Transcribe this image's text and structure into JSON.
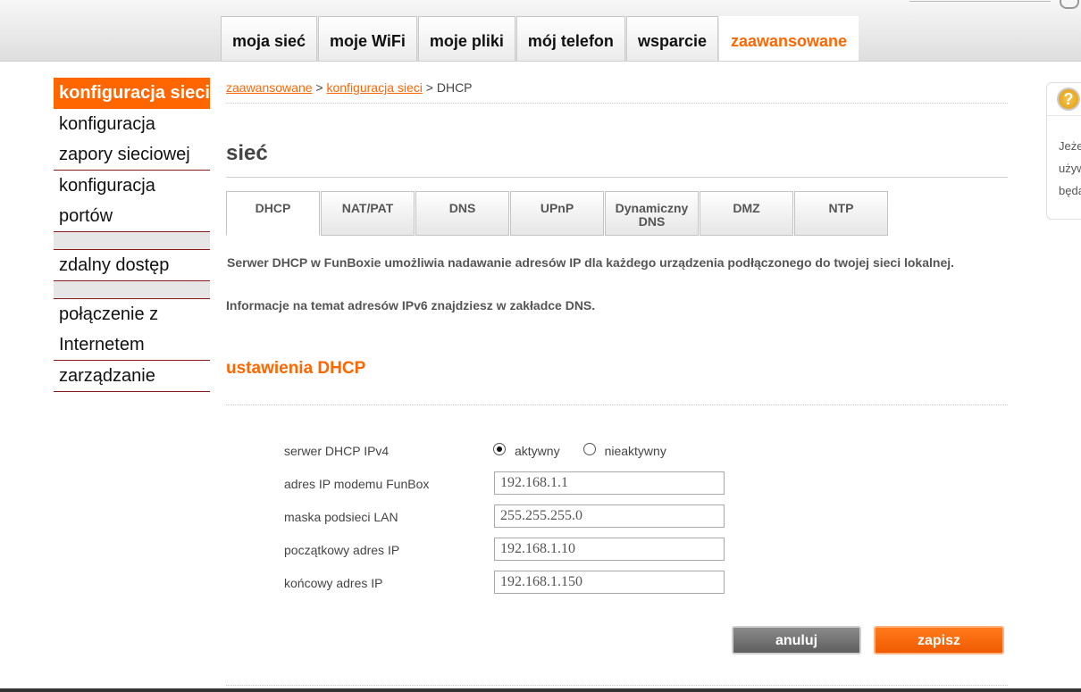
{
  "main_tabs": [
    {
      "label": "moja sieć"
    },
    {
      "label": "moje WiFi"
    },
    {
      "label": "moje pliki"
    },
    {
      "label": "mój telefon"
    },
    {
      "label": "wsparcie"
    },
    {
      "label": "zaawansowane",
      "active": true
    }
  ],
  "sidenav": {
    "item1": "konfiguracja sieci",
    "item2": "konfiguracja zapory sieciowej",
    "item3": "konfiguracja portów",
    "item4": "zdalny dostęp",
    "item5": "połączenie z Internetem",
    "item6": "zarządzanie"
  },
  "breadcrumb": {
    "level1": "zaawansowane",
    "sep1": ">",
    "level2": "konfiguracja sieci",
    "sep2": ">",
    "current": "DHCP"
  },
  "page_title": "sieć",
  "sub_tabs": {
    "dhcp": "DHCP",
    "natpat": "NAT/PAT",
    "dns": "DNS",
    "upnp": "UPnP",
    "dyndns_line1": "Dynamiczny",
    "dyndns_line2": "DNS",
    "dmz": "DMZ",
    "ntp": "NTP"
  },
  "description": {
    "line1": "Serwer DHCP w FunBoxie umożliwia nadawanie adresów IP dla każdego urządzenia podłączonego do twojej sieci lokalnej.",
    "line2": "Informacje na temat adresów IPv6 znajdziesz w zakładce DNS."
  },
  "section_title": "ustawienia DHCP",
  "form": {
    "dhcp_server_label": "serwer DHCP IPv4",
    "radio_active_label": "aktywny",
    "radio_inactive_label": "nieaktywny",
    "selected": "aktywny",
    "modem_ip_label": "adres IP modemu FunBox",
    "modem_ip_value": "192.168.1.1",
    "subnet_label": "maska podsieci LAN",
    "subnet_value": "255.255.255.0",
    "start_ip_label": "początkowy adres IP",
    "start_ip_value": "192.168.1.10",
    "end_ip_label": "końcowy adres IP",
    "end_ip_value": "192.168.1.150"
  },
  "buttons": {
    "cancel": "anuluj",
    "save": "zapisz"
  },
  "help": {
    "icon_glyph": "?",
    "line1": "Jeże",
    "line2": "używ",
    "line3": "będą"
  },
  "colors": {
    "accent": "#ff6600",
    "nav_border": "#8a1a1a",
    "cancel_button": "#6e6e6e"
  }
}
